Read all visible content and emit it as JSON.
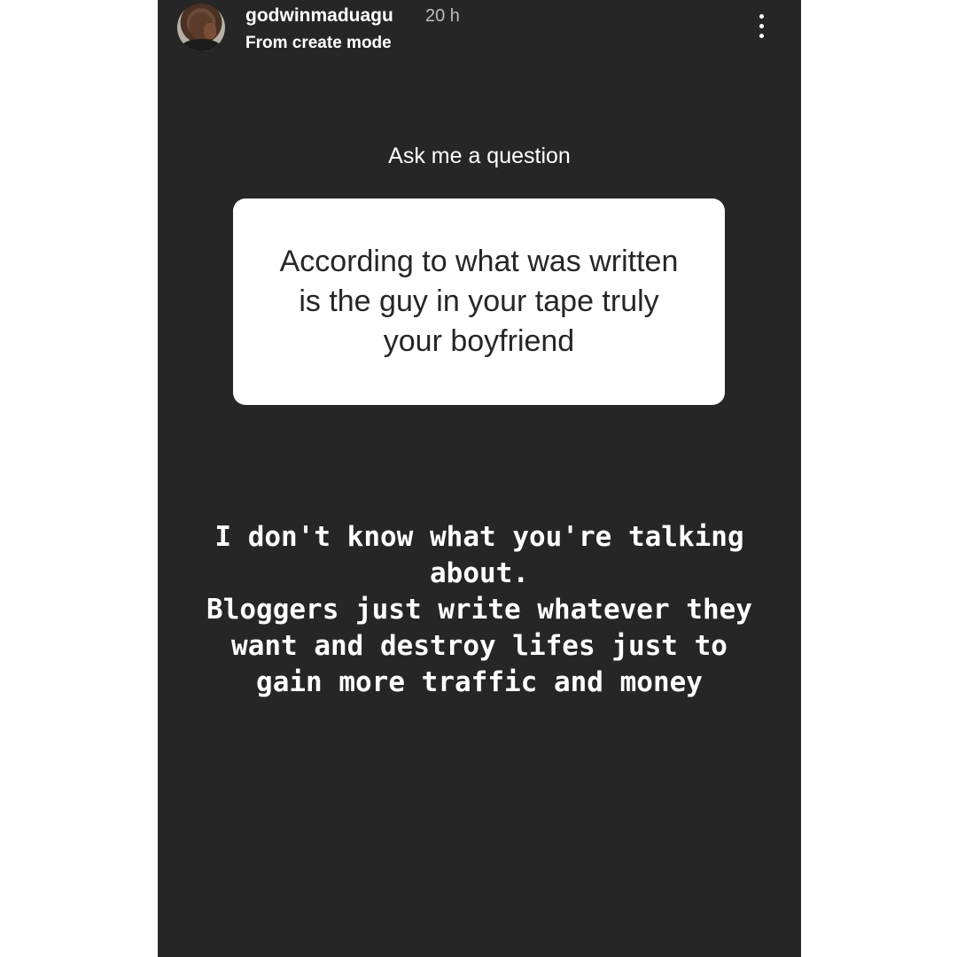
{
  "story": {
    "username": "godwinmaduagu",
    "time": "20 h",
    "subline": "From create mode",
    "menu_icon": "more-vertical-icon",
    "prompt": "Ask me a question",
    "question": "According to what was written is the guy in your tape truly your boyfriend",
    "answer": "I don't know what you're talking about.\nBloggers just write whatever they want and destroy lifes just to gain more traffic and money"
  },
  "colors": {
    "story_background": "#262626",
    "page_background": "#ffffff",
    "card_background": "#ffffff",
    "text_light": "#ffffff",
    "text_dark": "#262626"
  }
}
